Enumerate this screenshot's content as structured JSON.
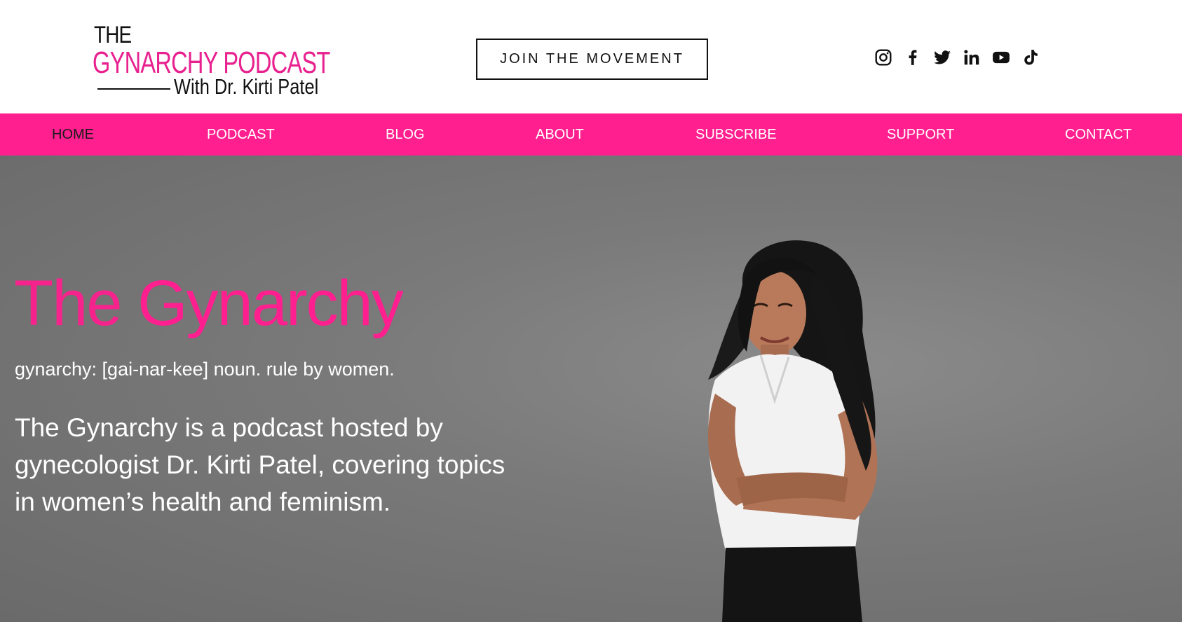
{
  "logo": {
    "line1": "THE",
    "line2": "GYNARCHY PODCAST",
    "line3": "With Dr. Kirti Patel"
  },
  "header": {
    "cta_label": "JOIN THE MOVEMENT",
    "social": [
      "instagram-icon",
      "facebook-icon",
      "twitter-icon",
      "linkedin-icon",
      "youtube-icon",
      "tiktok-icon"
    ]
  },
  "nav": {
    "items": [
      {
        "label": "HOME",
        "active": true
      },
      {
        "label": "PODCAST",
        "active": false
      },
      {
        "label": "BLOG",
        "active": false
      },
      {
        "label": "ABOUT",
        "active": false
      },
      {
        "label": "SUBSCRIBE",
        "active": false
      },
      {
        "label": "SUPPORT",
        "active": false
      },
      {
        "label": "CONTACT",
        "active": false
      }
    ]
  },
  "hero": {
    "title_the": "The",
    "title_gynarchy": "Gynarchy",
    "definition": "gynarchy: [gai-nar-kee] noun. rule by women.",
    "description": "The Gynarchy is a podcast hosted by gynecologist Dr. Kirti Patel, covering topics in women’s health and feminism."
  },
  "colors": {
    "brand_pink": "#ff1f8e",
    "logo_pink": "#e8218f",
    "hero_bg": "#7a7a7a",
    "text_dark": "#111111"
  }
}
